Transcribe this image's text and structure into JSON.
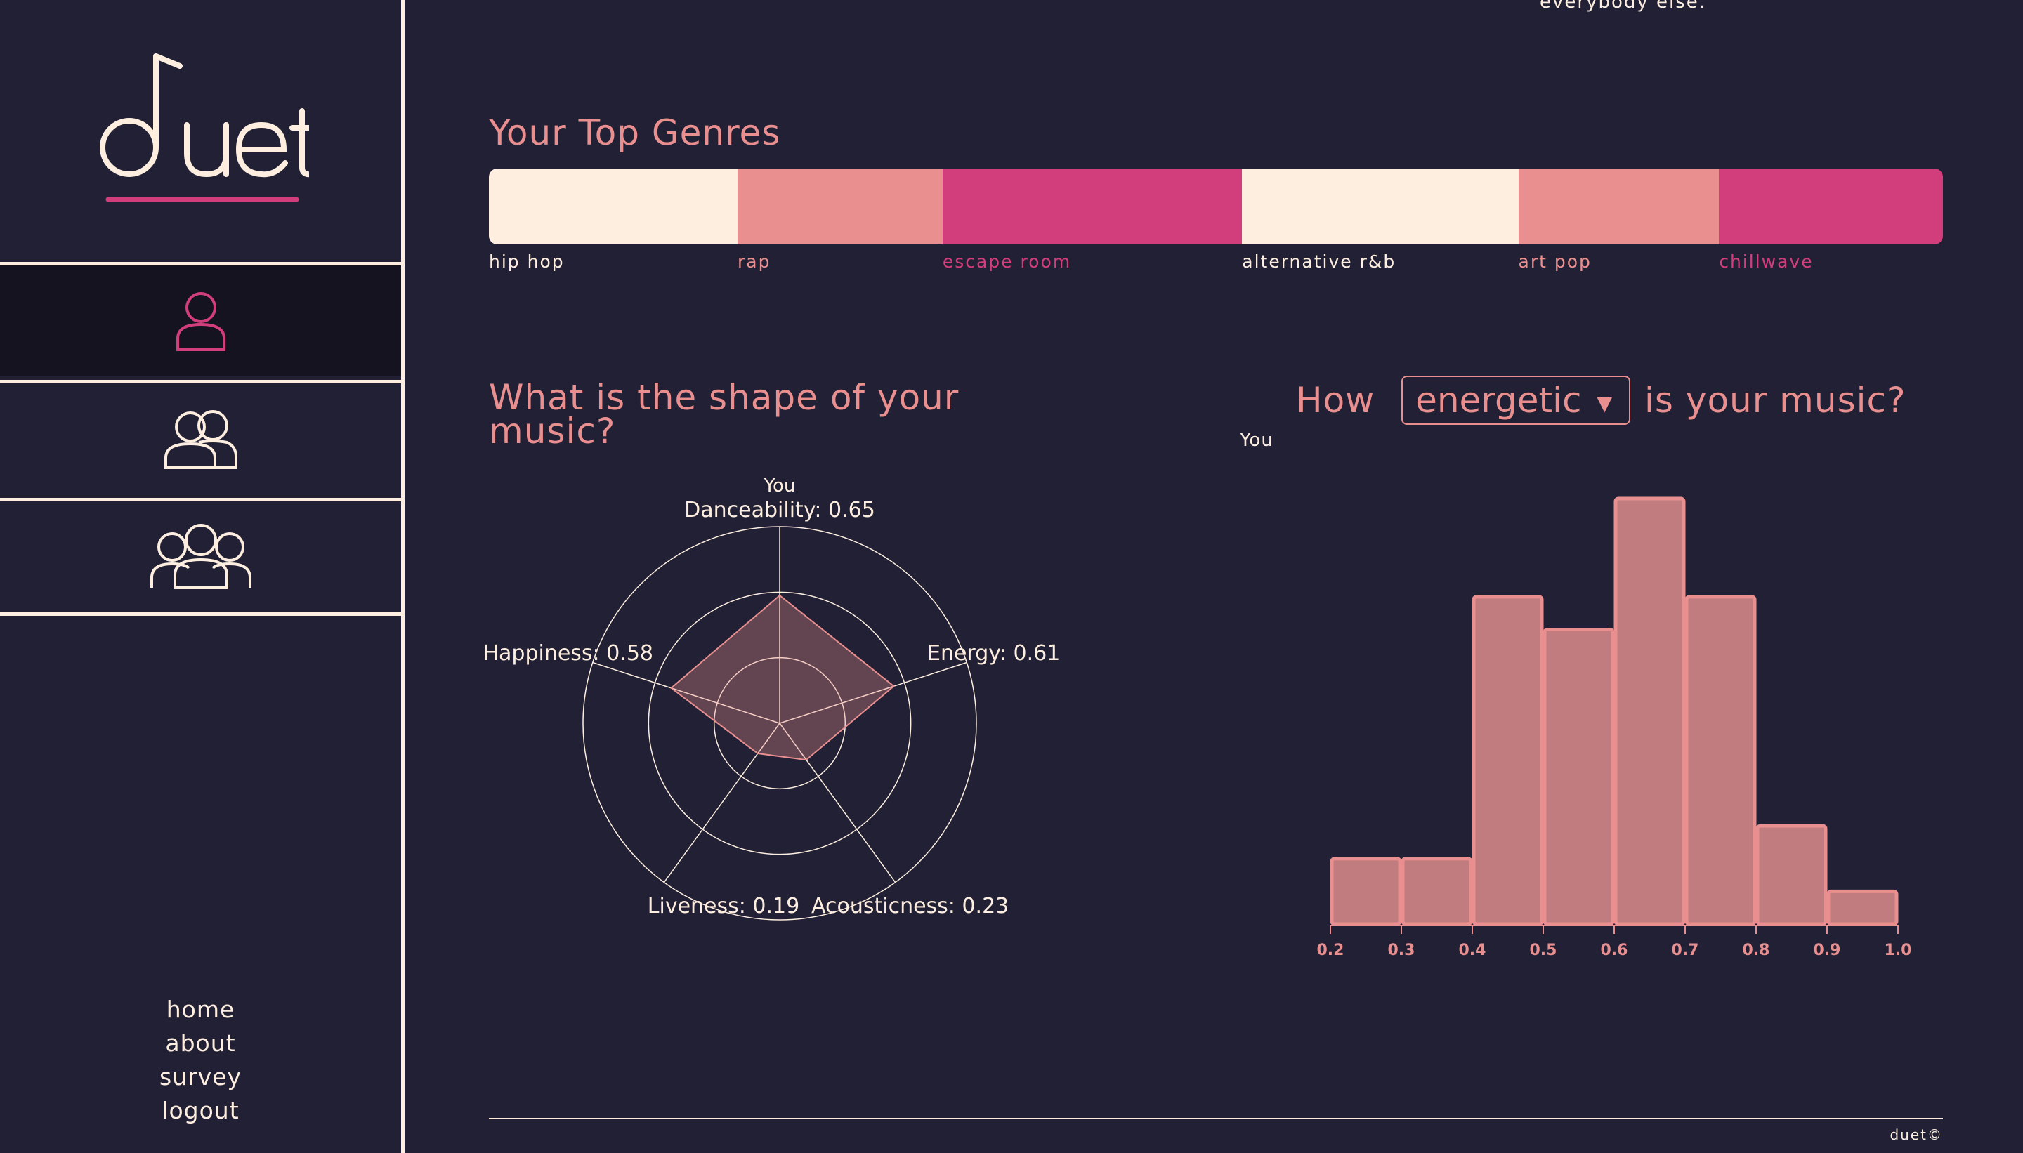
{
  "app": {
    "logo_text": "duet"
  },
  "sidebar": {
    "nav": [
      {
        "icon": "user-icon",
        "active": true
      },
      {
        "icon": "two-users-icon",
        "active": false
      },
      {
        "icon": "group-icon",
        "active": false
      }
    ],
    "footer_links": [
      "home",
      "about",
      "survey",
      "logout"
    ]
  },
  "top_snippet": "everybody else.",
  "genres": {
    "title": "Your Top Genres",
    "items": [
      {
        "label": "hip hop",
        "share": 0.171,
        "color": "#fdeee0"
      },
      {
        "label": "rap",
        "share": 0.141,
        "color": "#e98f8f"
      },
      {
        "label": "escape room",
        "share": 0.206,
        "color": "#d23e7c"
      },
      {
        "label": "alternative r&b",
        "share": 0.19,
        "color": "#fdeee0"
      },
      {
        "label": "art pop",
        "share": 0.138,
        "color": "#e98f8f"
      },
      {
        "label": "chillwave",
        "share": 0.154,
        "color": "#d23e7c"
      }
    ]
  },
  "shape": {
    "title_line1": "What is the shape of your",
    "title_line2": "music?"
  },
  "how": {
    "prefix": "How",
    "selected_metric": "energetic",
    "suffix": "is your music?",
    "series_label": "You"
  },
  "chart_data": [
    {
      "type": "radar",
      "series_name": "You",
      "axes": [
        "Danceability",
        "Energy",
        "Acousticness",
        "Liveness",
        "Happiness"
      ],
      "values": [
        0.65,
        0.61,
        0.23,
        0.19,
        0.58
      ],
      "labels": [
        "Danceability: 0.65",
        "Energy: 0.61",
        "Acousticness: 0.23",
        "Liveness: 0.19",
        "Happiness: 0.58"
      ],
      "rings": 3,
      "fill": "#e98f8f",
      "fill_opacity": 0.33
    },
    {
      "type": "bar",
      "categories": [
        "0.2-0.3",
        "0.3-0.4",
        "0.4-0.5",
        "0.5-0.6",
        "0.6-0.7",
        "0.7-0.8",
        "0.8-0.9",
        "0.9-1.0"
      ],
      "bin_edges": [
        0.2,
        0.3,
        0.4,
        0.5,
        0.6,
        0.7,
        0.8,
        0.9,
        1.0
      ],
      "tick_labels": [
        "0.2",
        "0.3",
        "0.4",
        "0.5",
        "0.6",
        "0.7",
        "0.8",
        "0.9",
        "1.0"
      ],
      "values": [
        2,
        2,
        10,
        9,
        13,
        10,
        3,
        1
      ],
      "ylim": [
        0,
        13
      ],
      "fill": "#c07c7f",
      "stroke": "#e98f8f"
    }
  ],
  "footer": {
    "copyright": "duet©"
  }
}
